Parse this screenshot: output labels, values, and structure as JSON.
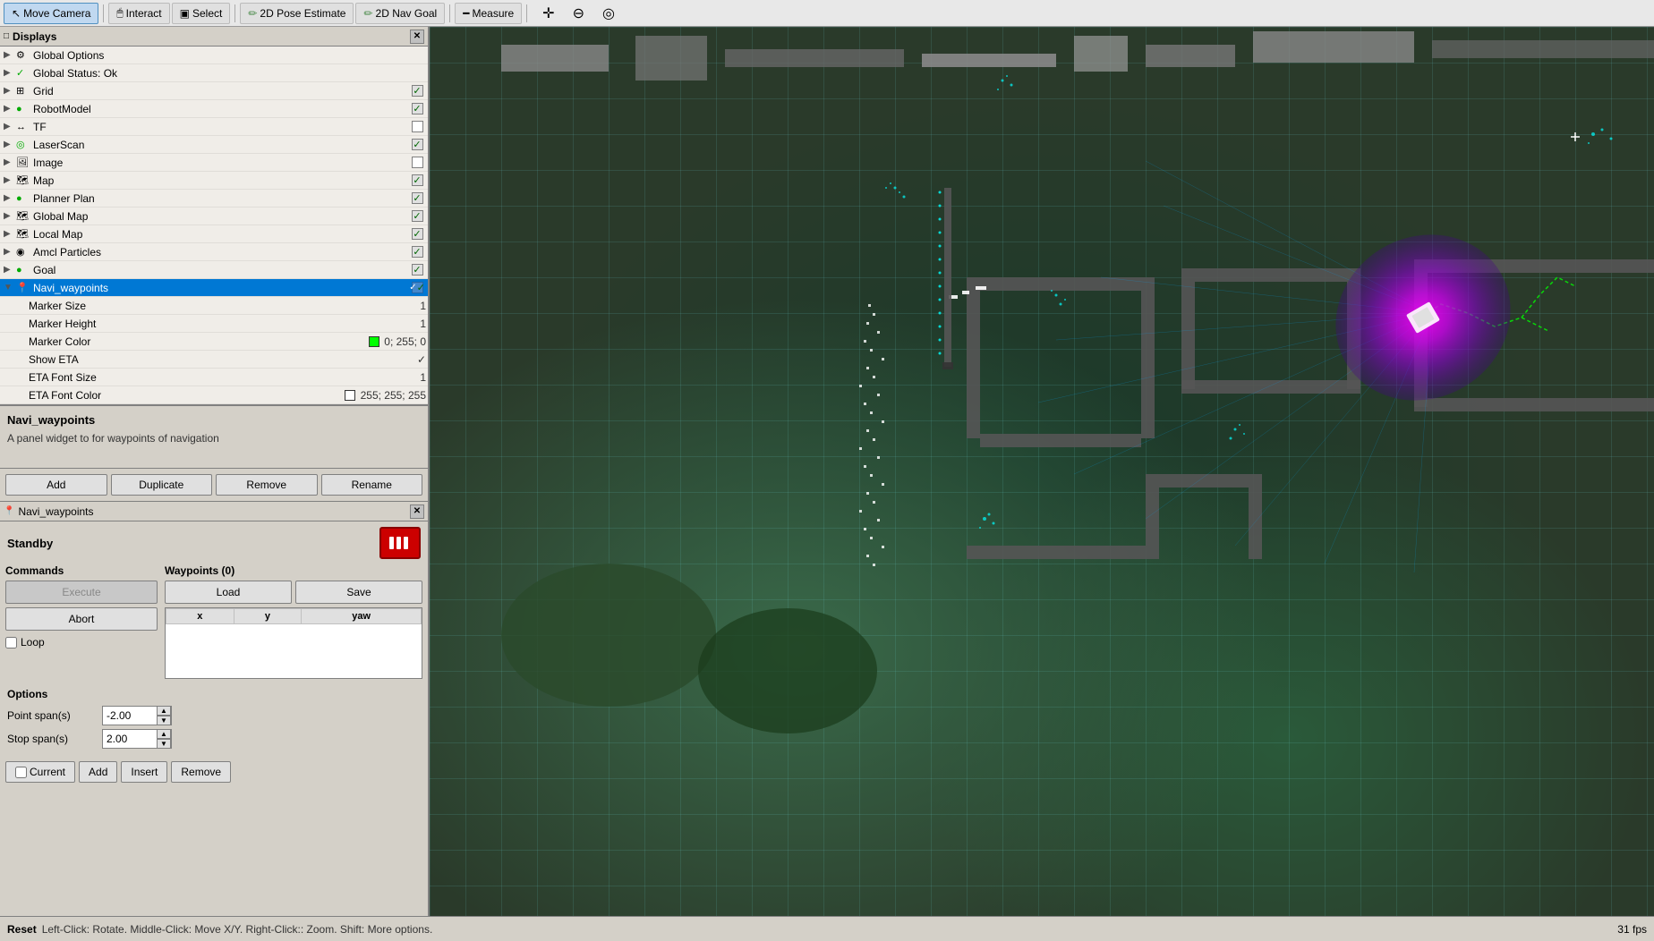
{
  "toolbar": {
    "buttons": [
      {
        "id": "move-camera",
        "label": "Move Camera",
        "icon": "↖",
        "active": true
      },
      {
        "id": "interact",
        "label": "Interact",
        "icon": "🖱"
      },
      {
        "id": "select",
        "label": "Select",
        "icon": "▣"
      },
      {
        "id": "pose-estimate",
        "label": "2D Pose Estimate",
        "icon": "✏"
      },
      {
        "id": "nav-goal",
        "label": "2D Nav Goal",
        "icon": "✏"
      },
      {
        "id": "measure",
        "label": "Measure",
        "icon": "━"
      }
    ],
    "extra_icons": [
      "✛",
      "⊖",
      "◎"
    ]
  },
  "displays_panel": {
    "title": "Displays",
    "items": [
      {
        "id": "global-options",
        "label": "Global Options",
        "indent": 0,
        "has_expand": true,
        "expanded": false,
        "icon": "⚙",
        "checked": null
      },
      {
        "id": "global-status",
        "label": "Global Status: Ok",
        "indent": 0,
        "has_expand": true,
        "expanded": false,
        "icon": "✓",
        "checked": null
      },
      {
        "id": "grid",
        "label": "Grid",
        "indent": 0,
        "has_expand": true,
        "expanded": false,
        "icon": "⊞",
        "checked": true
      },
      {
        "id": "robot-model",
        "label": "RobotModel",
        "indent": 0,
        "has_expand": true,
        "expanded": false,
        "icon": "🤖",
        "checked": true
      },
      {
        "id": "tf",
        "label": "TF",
        "indent": 0,
        "has_expand": true,
        "expanded": false,
        "icon": "🔀",
        "checked": false
      },
      {
        "id": "laser-scan",
        "label": "LaserScan",
        "indent": 0,
        "has_expand": true,
        "expanded": false,
        "icon": "📡",
        "checked": true
      },
      {
        "id": "image",
        "label": "Image",
        "indent": 0,
        "has_expand": true,
        "expanded": false,
        "icon": "🖼",
        "checked": false
      },
      {
        "id": "map",
        "label": "Map",
        "indent": 0,
        "has_expand": true,
        "expanded": false,
        "icon": "🗺",
        "checked": true
      },
      {
        "id": "planner-plan",
        "label": "Planner Plan",
        "indent": 0,
        "has_expand": true,
        "expanded": false,
        "icon": "📋",
        "checked": true
      },
      {
        "id": "global-map",
        "label": "Global Map",
        "indent": 0,
        "has_expand": true,
        "expanded": false,
        "icon": "🗺",
        "checked": true
      },
      {
        "id": "local-map",
        "label": "Local Map",
        "indent": 0,
        "has_expand": true,
        "expanded": false,
        "icon": "🗺",
        "checked": true
      },
      {
        "id": "amcl-particles",
        "label": "Amcl Particles",
        "indent": 0,
        "has_expand": true,
        "expanded": false,
        "icon": "◉",
        "checked": true
      },
      {
        "id": "goal",
        "label": "Goal",
        "indent": 0,
        "has_expand": true,
        "expanded": false,
        "icon": "🎯",
        "checked": true
      },
      {
        "id": "navi-waypoints",
        "label": "Navi_waypoints",
        "indent": 0,
        "has_expand": true,
        "expanded": true,
        "icon": "📍",
        "checked": true,
        "selected": true
      }
    ],
    "sub_items": [
      {
        "id": "marker-size",
        "label": "Marker Size",
        "value": "1"
      },
      {
        "id": "marker-height",
        "label": "Marker Height",
        "value": "1"
      },
      {
        "id": "marker-color",
        "label": "Marker Color",
        "value": "0; 255; 0",
        "color": "#00ff00"
      },
      {
        "id": "show-eta",
        "label": "Show ETA",
        "value": "✓"
      },
      {
        "id": "eta-font-size",
        "label": "ETA Font Size",
        "value": "1"
      },
      {
        "id": "eta-font-color",
        "label": "ETA Font Color",
        "value": "255; 255; 255",
        "color": "#ffffff"
      }
    ]
  },
  "description": {
    "title": "Navi_waypoints",
    "text": "A panel widget to for waypoints of navigation"
  },
  "display_buttons": {
    "add": "Add",
    "duplicate": "Duplicate",
    "remove": "Remove",
    "rename": "Rename"
  },
  "navi_widget": {
    "title": "Navi_waypoints",
    "standby_label": "Standby",
    "commands_label": "Commands",
    "waypoints_label": "Waypoints (0)",
    "execute_btn": "Execute",
    "abort_btn": "Abort",
    "loop_label": "Loop",
    "load_btn": "Load",
    "save_btn": "Save",
    "col_x": "x",
    "col_y": "y",
    "col_yaw": "yaw",
    "options_label": "Options",
    "point_span_label": "Point span(s)",
    "point_span_value": "-2.00",
    "stop_span_label": "Stop span(s)",
    "stop_span_value": "2.00",
    "current_btn": "Current",
    "add_wp_btn": "Add",
    "insert_btn": "Insert",
    "remove_wp_btn": "Remove"
  },
  "status_bar": {
    "reset_label": "Reset",
    "instructions": "Left-Click: Rotate.  Middle-Click: Move X/Y.  Right-Click:: Zoom.  Shift: More options.",
    "fps": "31 fps"
  }
}
